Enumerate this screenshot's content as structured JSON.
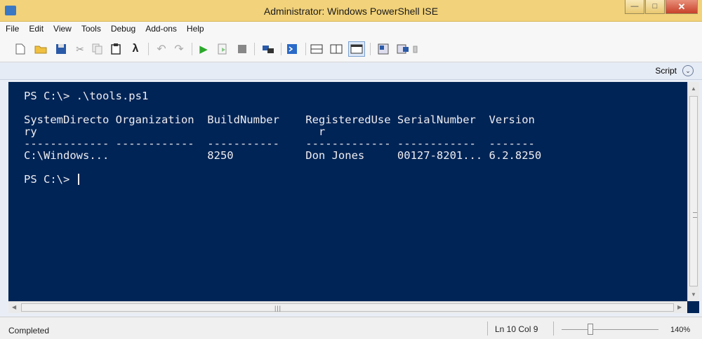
{
  "window": {
    "title": "Administrator: Windows PowerShell ISE",
    "buttons": [
      "minimize",
      "maximize",
      "close"
    ]
  },
  "menu": [
    "File",
    "Edit",
    "View",
    "Tools",
    "Debug",
    "Add-ons",
    "Help"
  ],
  "toolbar": {
    "icons": [
      "new-icon",
      "open-icon",
      "save-icon",
      "cut-icon",
      "copy-icon",
      "paste-icon",
      "clear-console-icon",
      "undo-icon",
      "redo-icon",
      "run-icon",
      "run-selection-icon",
      "stop-icon",
      "remote-powershell-icon",
      "powershell-console-icon",
      "show-script-top-icon",
      "show-script-right-icon",
      "show-script-maximized-icon",
      "show-command-icon",
      "show-addon-icon"
    ]
  },
  "tabstrip": {
    "script_label": "Script"
  },
  "console": {
    "prompt1": "PS C:\\> .\\tools.ps1",
    "headers1": "SystemDirecto Organization  BuildNumber    RegisteredUse SerialNumber  Version",
    "headers2": "ry                                           r",
    "dashes": "------------- ------------  -----------    ------------- ------------  -------",
    "row": "C:\\Windows...               8250           Don Jones     00127-8201... 6.2.8250",
    "prompt2": "PS C:\\> ",
    "colors": {
      "background": "#012456",
      "foreground": "#eeedf0"
    }
  },
  "status": {
    "text": "Completed",
    "position": "Ln 10  Col 9",
    "zoom": "140%",
    "zoom_slider_fraction": 0.3
  }
}
